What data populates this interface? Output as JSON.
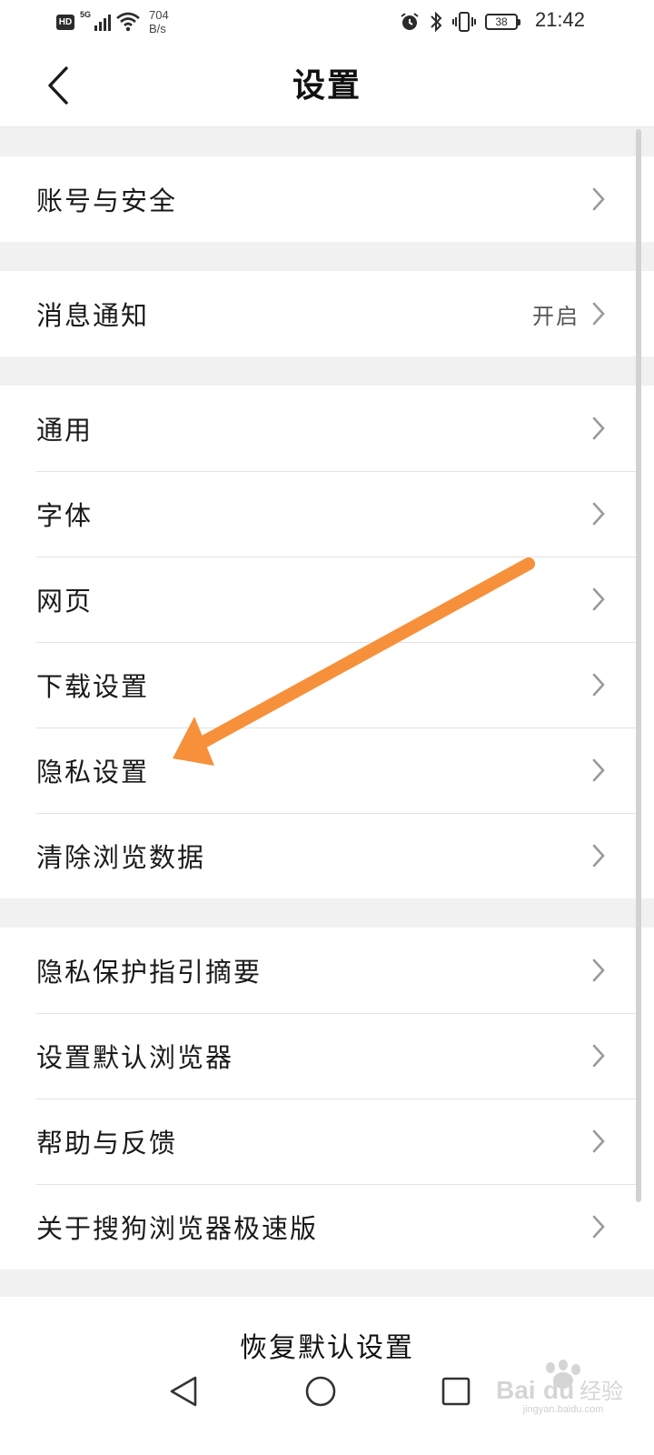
{
  "status_bar": {
    "hd_badge": "HD",
    "network_type": "5G",
    "speed_value": "704",
    "speed_unit": "B/s",
    "battery_level": "38",
    "time": "21:42"
  },
  "header": {
    "title": "设置"
  },
  "groups": [
    {
      "items": [
        {
          "label": "账号与安全"
        }
      ]
    },
    {
      "items": [
        {
          "label": "消息通知",
          "value": "开启"
        }
      ]
    },
    {
      "items": [
        {
          "label": "通用"
        },
        {
          "label": "字体"
        },
        {
          "label": "网页"
        },
        {
          "label": "下载设置"
        },
        {
          "label": "隐私设置"
        },
        {
          "label": "清除浏览数据"
        }
      ]
    },
    {
      "items": [
        {
          "label": "隐私保护指引摘要"
        },
        {
          "label": "设置默认浏览器"
        },
        {
          "label": "帮助与反馈"
        },
        {
          "label": "关于搜狗浏览器极速版"
        }
      ]
    }
  ],
  "footer": {
    "restore_label": "恢复默认设置"
  },
  "annotation": {
    "arrow_color": "#f7903a",
    "target": "隐私设置"
  },
  "watermark": {
    "brand": "Baidu经验",
    "url": "jingyan.baidu.com"
  },
  "colors": {
    "background": "#f1f1f1",
    "card": "#ffffff",
    "divider": "#e2e2e2",
    "chevron": "#9a9a9a"
  }
}
